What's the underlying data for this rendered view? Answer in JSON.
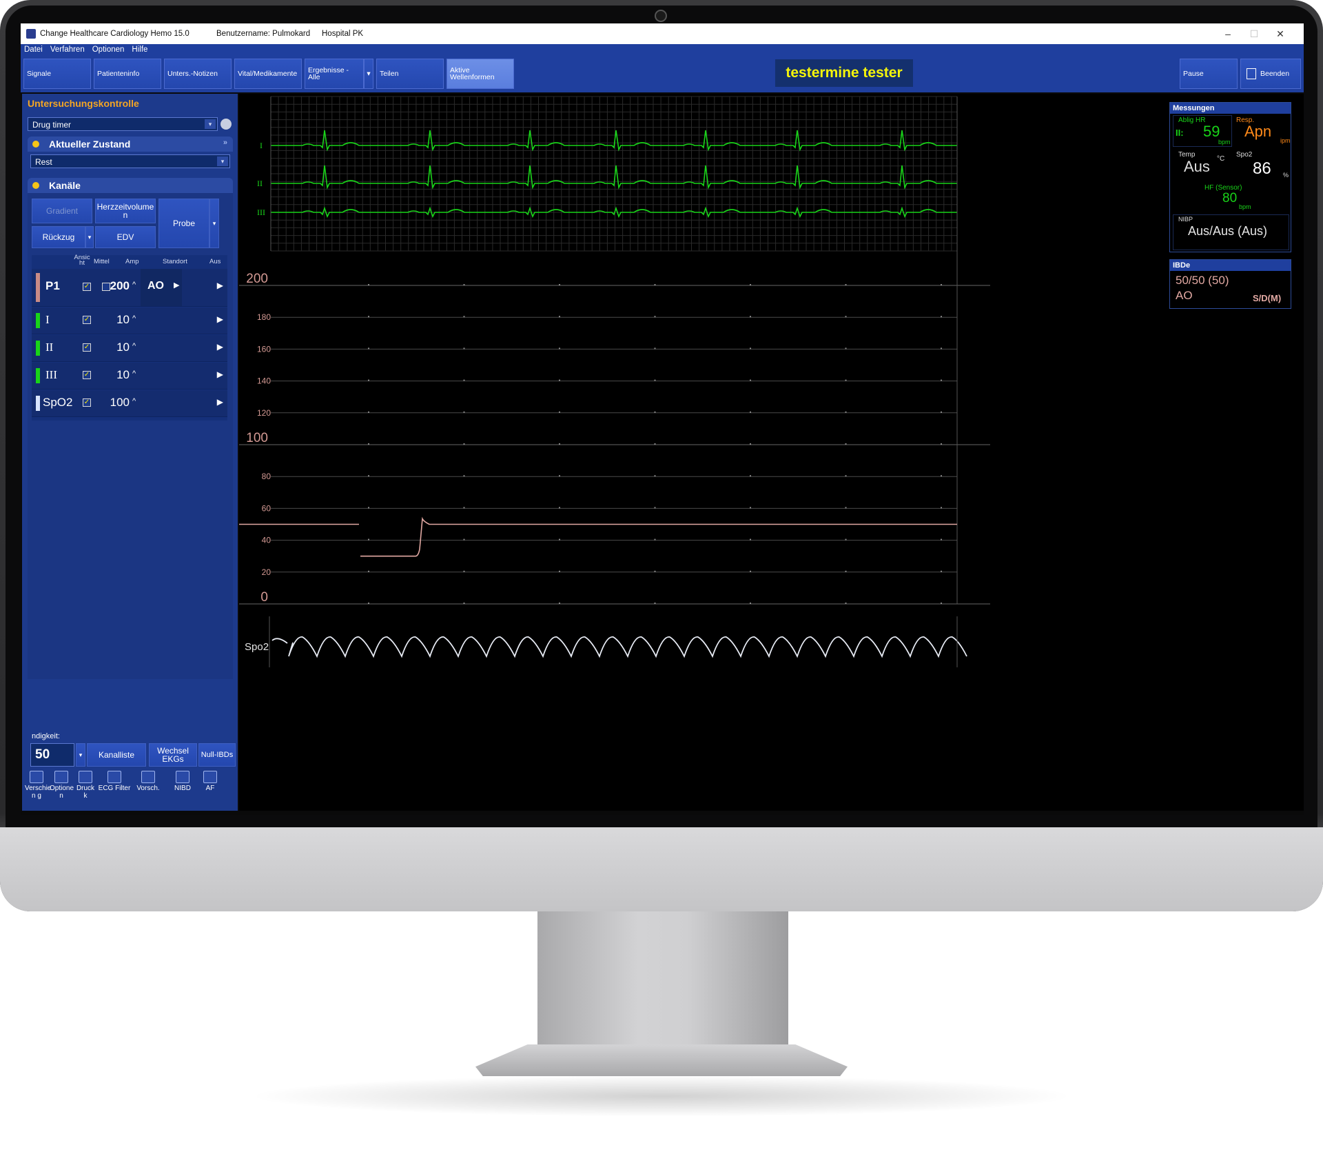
{
  "window": {
    "title": "Change Healthcare Cardiology Hemo 15.0",
    "username": "Benutzername: Pulmokard",
    "hospital": "Hospital PK",
    "controls": [
      "–",
      "☐",
      "✕"
    ]
  },
  "menu": [
    "Datei",
    "Verfahren",
    "Optionen",
    "Hilfe"
  ],
  "toolbar": {
    "buttons": [
      {
        "label": "Signale"
      },
      {
        "label": "Patienteninfo"
      },
      {
        "label": "Unters.-Notizen"
      },
      {
        "label": "Vital/Medikamente"
      },
      {
        "label": "Ergebnisse - Alle"
      },
      {
        "label": "Teilen"
      },
      {
        "label": "Aktive Wellenformen"
      }
    ],
    "patient_name": "testermine tester",
    "pause_label": "Pause",
    "exit_label": "Beenden"
  },
  "left_panel": {
    "title": "Untersuchungskontrolle",
    "timer_dropdown": "Drug timer",
    "state_section": "Aktueller Zustand",
    "state_value": "Rest",
    "channels_section": "Kanäle",
    "buttons": {
      "gradient": "Gradient",
      "cardiac_output": "Herzzeitvolume n",
      "pullback": "Rückzug",
      "edv": "EDV",
      "sample": "Probe"
    },
    "table_headers": [
      "Ansic ht",
      "Mittel",
      "Amp",
      "Standort",
      "Aus"
    ],
    "channels": [
      {
        "name": "P1",
        "amp": "200",
        "location": "AO",
        "color": "#c98b86"
      },
      {
        "name": "I",
        "amp": "10",
        "location": "",
        "color": "#19d419"
      },
      {
        "name": "II",
        "amp": "10",
        "location": "",
        "color": "#19d419"
      },
      {
        "name": "III",
        "amp": "10",
        "location": "",
        "color": "#19d419"
      },
      {
        "name": "SpO2",
        "amp": "100",
        "location": "",
        "color": "#d8e4ff"
      }
    ],
    "speed_label": "ndigkeit:",
    "speed_value": "50",
    "bottom_buttons": [
      "Kanalliste",
      "Wechsel EKGs",
      "Null-IBDs"
    ],
    "tools": [
      "Verschie n g",
      "Optione n",
      "Druck k",
      "ECG Filter",
      "Vorsch.",
      "NIBD",
      "AF"
    ]
  },
  "waveforms": {
    "ecg_labels": [
      "I",
      "II",
      "III"
    ],
    "pressure_scale_labels": [
      "200",
      "180",
      "160",
      "140",
      "120",
      "100",
      "80",
      "60",
      "40",
      "20",
      "0"
    ],
    "spo2_label": "Spo2"
  },
  "measurements": {
    "title": "Messungen",
    "hr_label": "Ablig HR",
    "hr_lead": "II:",
    "hr_value": "59",
    "hr_unit": "bpm",
    "resp_label": "Resp.",
    "resp_value": "Apn",
    "resp_unit": "ipm",
    "temp_label": "Temp",
    "temp_value": "Aus",
    "temp_unit": "°C",
    "spo2_label": "Spo2",
    "spo2_value": "86",
    "spo2_unit": "%",
    "hf_label": "HF (Sensor)",
    "hf_value": "80",
    "hf_unit": "bpm",
    "nibp_label": "NIBP",
    "nibp_value": "Aus/Aus (Aus)"
  },
  "ibd": {
    "title": "IBDe",
    "value": "50/50 (50)",
    "location": "AO",
    "mode": "S/D(M)"
  },
  "colors": {
    "toolbar_blue": "#1f3f9e",
    "ecg_green": "#19d419",
    "pressure_pink": "#e2a9a3",
    "patient_yellow": "#f5f50a",
    "resp_orange": "#ff8a1a"
  }
}
